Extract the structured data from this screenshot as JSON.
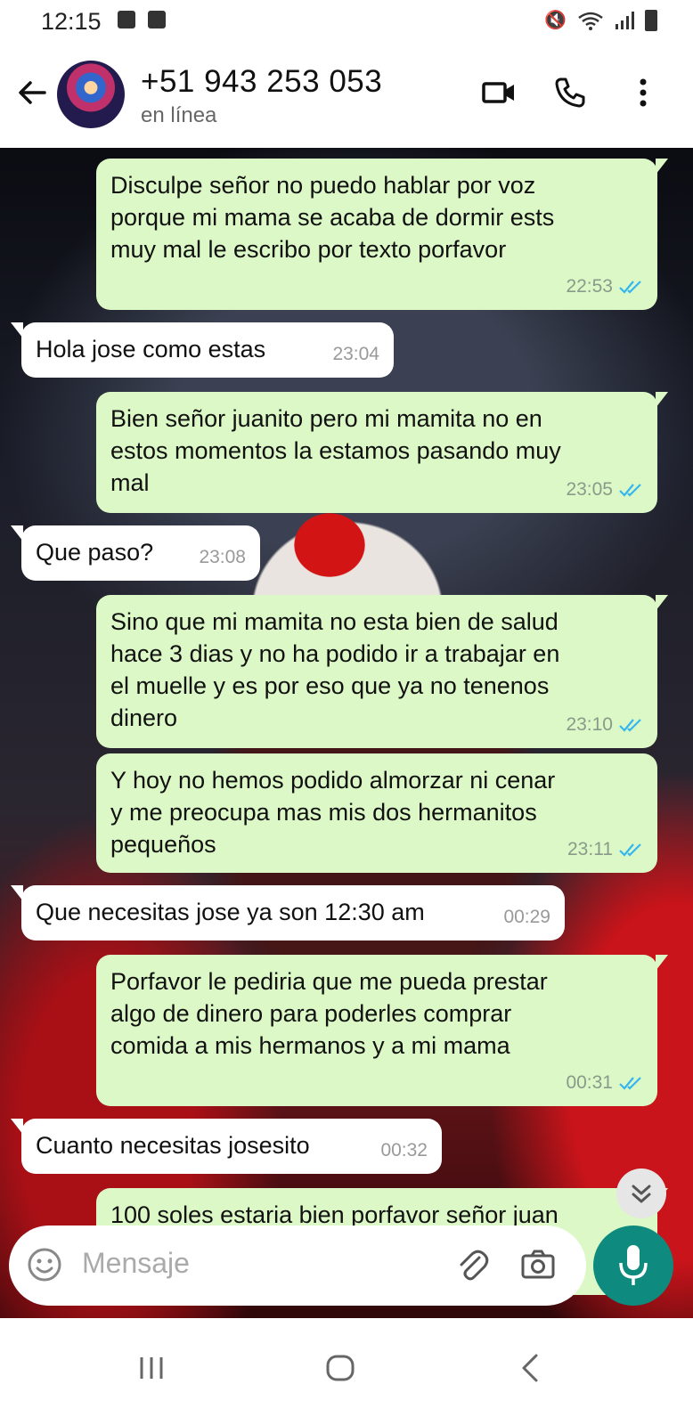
{
  "status_bar": {
    "time": "12:15"
  },
  "header": {
    "contact_name": "+51 943 253 053",
    "contact_status": "en línea"
  },
  "messages": [
    {
      "direction": "out",
      "text": "Disculpe señor no puedo hablar por voz\nporque mi mama se acaba de dormir ests\nmuy mal le escribo por texto porfavor",
      "time": "22:53",
      "read": true
    },
    {
      "direction": "in",
      "text": "Hola jose como estas",
      "time": "23:04"
    },
    {
      "direction": "out",
      "text": "Bien señor juanito pero mi mamita no en\nestos momentos la estamos pasando muy\nmal",
      "time": "23:05",
      "read": true
    },
    {
      "direction": "in",
      "text": "Que paso?",
      "time": "23:08"
    },
    {
      "direction": "out",
      "text": "Sino que mi mamita no esta bien de salud\nhace 3 dias y no ha podido ir a trabajar en\nel muelle y es por eso que ya no tenenos\ndinero",
      "time": "23:10",
      "read": true
    },
    {
      "direction": "out",
      "text": "Y hoy no hemos podido almorzar ni cenar\ny me preocupa mas mis dos hermanitos\npequeños",
      "time": "23:11",
      "read": true
    },
    {
      "direction": "in",
      "text": "Que necesitas jose ya son 12:30 am",
      "time": "00:29"
    },
    {
      "direction": "out",
      "text": "Porfavor le pediria que me pueda prestar\nalgo de dinero para poderles comprar\ncomida a mis hermanos y a mi mama",
      "time": "00:31",
      "read": true
    },
    {
      "direction": "in",
      "text": "Cuanto necesitas josesito",
      "time": "00:32"
    },
    {
      "direction": "out",
      "text": "100 soles estaria bien porfavor señor juan",
      "time": "",
      "read": false
    }
  ],
  "composer": {
    "placeholder": "Mensaje"
  },
  "icons": {
    "back": "arrow-left-icon",
    "video_call": "video-camera-icon",
    "voice_call": "phone-icon",
    "menu": "more-vertical-icon",
    "emoji": "emoji-icon",
    "attach": "paperclip-icon",
    "camera": "camera-icon",
    "mic": "microphone-icon",
    "scroll_down": "double-chevron-down-icon"
  },
  "colors": {
    "outgoing_bubble": "#dcf8c6",
    "incoming_bubble": "#ffffff",
    "read_tick": "#34b7f1",
    "mic_button": "#0e8a7e"
  }
}
